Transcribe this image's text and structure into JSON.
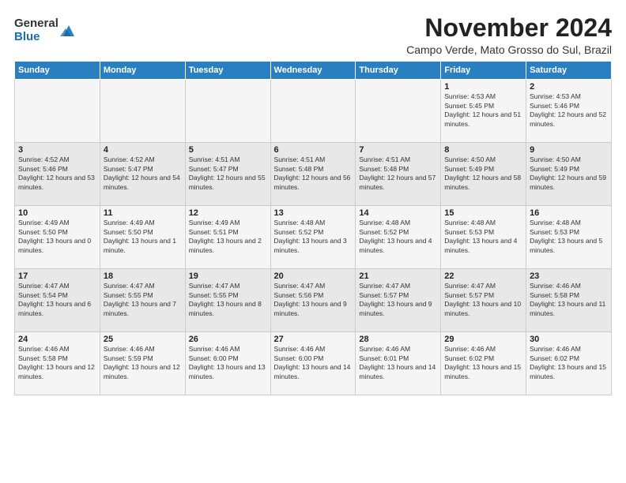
{
  "logo": {
    "general": "General",
    "blue": "Blue"
  },
  "title": {
    "month_year": "November 2024",
    "location": "Campo Verde, Mato Grosso do Sul, Brazil"
  },
  "days_of_week": [
    "Sunday",
    "Monday",
    "Tuesday",
    "Wednesday",
    "Thursday",
    "Friday",
    "Saturday"
  ],
  "weeks": [
    [
      {
        "day": "",
        "sunrise": "",
        "sunset": "",
        "daylight": "",
        "empty": true
      },
      {
        "day": "",
        "sunrise": "",
        "sunset": "",
        "daylight": "",
        "empty": true
      },
      {
        "day": "",
        "sunrise": "",
        "sunset": "",
        "daylight": "",
        "empty": true
      },
      {
        "day": "",
        "sunrise": "",
        "sunset": "",
        "daylight": "",
        "empty": true
      },
      {
        "day": "",
        "sunrise": "",
        "sunset": "",
        "daylight": "",
        "empty": true
      },
      {
        "day": "1",
        "sunrise": "Sunrise: 4:53 AM",
        "sunset": "Sunset: 5:45 PM",
        "daylight": "Daylight: 12 hours and 51 minutes.",
        "empty": false
      },
      {
        "day": "2",
        "sunrise": "Sunrise: 4:53 AM",
        "sunset": "Sunset: 5:46 PM",
        "daylight": "Daylight: 12 hours and 52 minutes.",
        "empty": false
      }
    ],
    [
      {
        "day": "3",
        "sunrise": "Sunrise: 4:52 AM",
        "sunset": "Sunset: 5:46 PM",
        "daylight": "Daylight: 12 hours and 53 minutes.",
        "empty": false
      },
      {
        "day": "4",
        "sunrise": "Sunrise: 4:52 AM",
        "sunset": "Sunset: 5:47 PM",
        "daylight": "Daylight: 12 hours and 54 minutes.",
        "empty": false
      },
      {
        "day": "5",
        "sunrise": "Sunrise: 4:51 AM",
        "sunset": "Sunset: 5:47 PM",
        "daylight": "Daylight: 12 hours and 55 minutes.",
        "empty": false
      },
      {
        "day": "6",
        "sunrise": "Sunrise: 4:51 AM",
        "sunset": "Sunset: 5:48 PM",
        "daylight": "Daylight: 12 hours and 56 minutes.",
        "empty": false
      },
      {
        "day": "7",
        "sunrise": "Sunrise: 4:51 AM",
        "sunset": "Sunset: 5:48 PM",
        "daylight": "Daylight: 12 hours and 57 minutes.",
        "empty": false
      },
      {
        "day": "8",
        "sunrise": "Sunrise: 4:50 AM",
        "sunset": "Sunset: 5:49 PM",
        "daylight": "Daylight: 12 hours and 58 minutes.",
        "empty": false
      },
      {
        "day": "9",
        "sunrise": "Sunrise: 4:50 AM",
        "sunset": "Sunset: 5:49 PM",
        "daylight": "Daylight: 12 hours and 59 minutes.",
        "empty": false
      }
    ],
    [
      {
        "day": "10",
        "sunrise": "Sunrise: 4:49 AM",
        "sunset": "Sunset: 5:50 PM",
        "daylight": "Daylight: 13 hours and 0 minutes.",
        "empty": false
      },
      {
        "day": "11",
        "sunrise": "Sunrise: 4:49 AM",
        "sunset": "Sunset: 5:50 PM",
        "daylight": "Daylight: 13 hours and 1 minute.",
        "empty": false
      },
      {
        "day": "12",
        "sunrise": "Sunrise: 4:49 AM",
        "sunset": "Sunset: 5:51 PM",
        "daylight": "Daylight: 13 hours and 2 minutes.",
        "empty": false
      },
      {
        "day": "13",
        "sunrise": "Sunrise: 4:48 AM",
        "sunset": "Sunset: 5:52 PM",
        "daylight": "Daylight: 13 hours and 3 minutes.",
        "empty": false
      },
      {
        "day": "14",
        "sunrise": "Sunrise: 4:48 AM",
        "sunset": "Sunset: 5:52 PM",
        "daylight": "Daylight: 13 hours and 4 minutes.",
        "empty": false
      },
      {
        "day": "15",
        "sunrise": "Sunrise: 4:48 AM",
        "sunset": "Sunset: 5:53 PM",
        "daylight": "Daylight: 13 hours and 4 minutes.",
        "empty": false
      },
      {
        "day": "16",
        "sunrise": "Sunrise: 4:48 AM",
        "sunset": "Sunset: 5:53 PM",
        "daylight": "Daylight: 13 hours and 5 minutes.",
        "empty": false
      }
    ],
    [
      {
        "day": "17",
        "sunrise": "Sunrise: 4:47 AM",
        "sunset": "Sunset: 5:54 PM",
        "daylight": "Daylight: 13 hours and 6 minutes.",
        "empty": false
      },
      {
        "day": "18",
        "sunrise": "Sunrise: 4:47 AM",
        "sunset": "Sunset: 5:55 PM",
        "daylight": "Daylight: 13 hours and 7 minutes.",
        "empty": false
      },
      {
        "day": "19",
        "sunrise": "Sunrise: 4:47 AM",
        "sunset": "Sunset: 5:55 PM",
        "daylight": "Daylight: 13 hours and 8 minutes.",
        "empty": false
      },
      {
        "day": "20",
        "sunrise": "Sunrise: 4:47 AM",
        "sunset": "Sunset: 5:56 PM",
        "daylight": "Daylight: 13 hours and 9 minutes.",
        "empty": false
      },
      {
        "day": "21",
        "sunrise": "Sunrise: 4:47 AM",
        "sunset": "Sunset: 5:57 PM",
        "daylight": "Daylight: 13 hours and 9 minutes.",
        "empty": false
      },
      {
        "day": "22",
        "sunrise": "Sunrise: 4:47 AM",
        "sunset": "Sunset: 5:57 PM",
        "daylight": "Daylight: 13 hours and 10 minutes.",
        "empty": false
      },
      {
        "day": "23",
        "sunrise": "Sunrise: 4:46 AM",
        "sunset": "Sunset: 5:58 PM",
        "daylight": "Daylight: 13 hours and 11 minutes.",
        "empty": false
      }
    ],
    [
      {
        "day": "24",
        "sunrise": "Sunrise: 4:46 AM",
        "sunset": "Sunset: 5:58 PM",
        "daylight": "Daylight: 13 hours and 12 minutes.",
        "empty": false
      },
      {
        "day": "25",
        "sunrise": "Sunrise: 4:46 AM",
        "sunset": "Sunset: 5:59 PM",
        "daylight": "Daylight: 13 hours and 12 minutes.",
        "empty": false
      },
      {
        "day": "26",
        "sunrise": "Sunrise: 4:46 AM",
        "sunset": "Sunset: 6:00 PM",
        "daylight": "Daylight: 13 hours and 13 minutes.",
        "empty": false
      },
      {
        "day": "27",
        "sunrise": "Sunrise: 4:46 AM",
        "sunset": "Sunset: 6:00 PM",
        "daylight": "Daylight: 13 hours and 14 minutes.",
        "empty": false
      },
      {
        "day": "28",
        "sunrise": "Sunrise: 4:46 AM",
        "sunset": "Sunset: 6:01 PM",
        "daylight": "Daylight: 13 hours and 14 minutes.",
        "empty": false
      },
      {
        "day": "29",
        "sunrise": "Sunrise: 4:46 AM",
        "sunset": "Sunset: 6:02 PM",
        "daylight": "Daylight: 13 hours and 15 minutes.",
        "empty": false
      },
      {
        "day": "30",
        "sunrise": "Sunrise: 4:46 AM",
        "sunset": "Sunset: 6:02 PM",
        "daylight": "Daylight: 13 hours and 15 minutes.",
        "empty": false
      }
    ]
  ]
}
